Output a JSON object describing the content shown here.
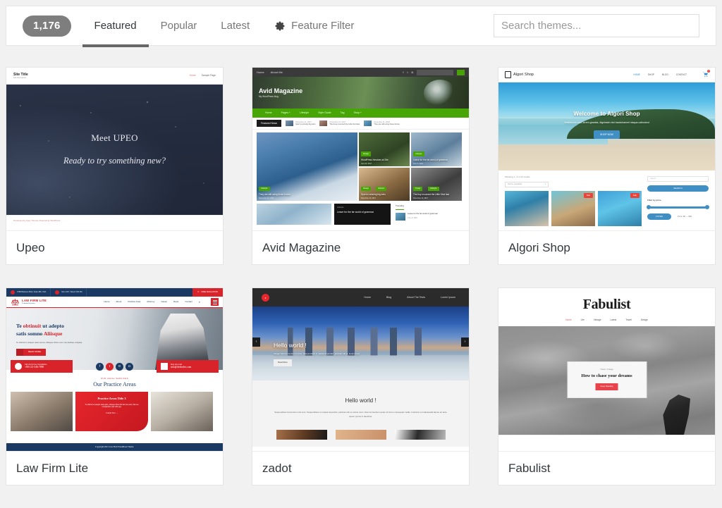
{
  "header": {
    "theme_count": "1,176",
    "tabs": [
      {
        "label": "Featured",
        "active": true
      },
      {
        "label": "Popular",
        "active": false
      },
      {
        "label": "Latest",
        "active": false
      }
    ],
    "feature_filter_label": "Feature Filter",
    "search_placeholder": "Search themes...",
    "search_value": ""
  },
  "themes": [
    {
      "name": "Upeo",
      "site_title": "Site Title",
      "site_tagline": "Site Description",
      "nav": [
        "Home",
        "Sample Page"
      ],
      "hero_line1": "Meet UPEO",
      "hero_line2": "Ready to try something new?",
      "footer": "Developed by Upeo Themes. Powered by WordPress."
    },
    {
      "name": "Avid Magazine",
      "topnav": [
        "Home",
        "About Me"
      ],
      "logo_title": "Avid Magazine",
      "logo_sub": "My WordPress blog",
      "nav": [
        "Home",
        "Pages +",
        "Lifestyle",
        "Style Guide",
        "Tag",
        "Shop +"
      ],
      "featured_tag": "Featured News",
      "featured_items": [
        {
          "date": "November 21, 2017",
          "title": "Sport is winning big wins"
        },
        {
          "date": "November 14, 2017",
          "title": "The boys mourned the Little Kind last"
        },
        {
          "date": "November 11, 2018",
          "title": "They are still using those forces"
        }
      ],
      "posts": [
        {
          "cat": "Lifestyle",
          "title": "They are still using those forces",
          "date": "November 21, 2018"
        },
        {
          "cat": "Design",
          "title": "WordPress Newbies at Site",
          "date": "June 24, 2017"
        },
        {
          "cat": "Lifestyle",
          "title": "Leave for the far world of grammar",
          "date": "June 6, 2018"
        },
        {
          "cat": "Design",
          "cat2": "Fashion",
          "title": "Sport is winning big wins",
          "date": "November 11, 2017"
        },
        {
          "cat": "Travel",
          "cat2": "Lifestyle",
          "title": "The boy mourned the Little Kind last",
          "date": "November 11, 2017"
        }
      ],
      "bottom_dark": {
        "cat": "Lifestyle",
        "title": "Leave for the far world of grammar"
      },
      "trending_label": "Trending",
      "trending_item": {
        "title": "Leave for the far world of grammar",
        "date": "June 6, 2018"
      }
    },
    {
      "name": "Algori Shop",
      "logo": "Algori Shop",
      "nav": [
        "HOME",
        "SHOP",
        "BLOG",
        "CONTACT"
      ],
      "cart_count": "0",
      "hero_title": "Welcome to Algori Shop",
      "hero_sub": "Vestibulum sed, lorem gravida, dignissim nisl backchannel nisqua callooked",
      "hero_button": "SHOP NOW",
      "results_text": "Showing 1 - 9 of 12 results",
      "sort_label": "Sort by popularity",
      "product_badge": "Sale",
      "search_placeholder": "Search...",
      "search_button": "SEARCH",
      "filter_title": "Filter by price",
      "filter_button": "FILTER",
      "price_range": "Price: $0 — $90"
    },
    {
      "name": "Law Firm Lite",
      "topbar": [
        "4789 Bellevue Blvd, Suite 380, USA",
        "Mon 24/7, Week 9:30 AM"
      ],
      "topbar_cta": "FREE EVALUATION",
      "logo_title": "LAW FIRM LITE",
      "logo_sub": "To defend of justice",
      "nav": [
        "Home",
        "About",
        "Practice Area",
        "Attorney",
        "Cases",
        "News",
        "Contact"
      ],
      "hero_title_1": "Te ",
      "hero_title_em": "obtinuit",
      "hero_title_2": " ut adepto",
      "hero_title_3": "satis somno ",
      "hero_title_em2": "Aliisque",
      "hero_sub": "Te obtinuit ut adepto satis somno. Aliisque tribus nunc mei deliciae voluptas.",
      "hero_button": "READ MORE",
      "call_label": "Call Us For Free Consultation",
      "call_number": "+88-123-546-7890",
      "email_label": "Drop Us a mail",
      "email_value": "info@defendex.com",
      "section_sub": "OUR LEGAL SERVICES",
      "section_title": "Our Practice Areas",
      "card_title": "Practice Areas Title 3",
      "card_text": "Te obtinuit ut adepto satis optio, aliisque tribus illa fac luar erant, illa mei complectitur pari mihi ego.",
      "card_link": "Consult Now →",
      "footer": "Copyright 2021 Law Firm WordPress Theme."
    },
    {
      "name": "zadot",
      "nav": [
        "Home",
        "Blog",
        "About The Tests",
        "Lorem Ipsum"
      ],
      "hero_title": "Hello world !",
      "hero_sub": "Integer felis fermentum in duis. Suspendisse in massa imperdiet, pulvinar elit ut, luctus nunc.",
      "hero_button": "Read More",
      "main_title": "Hello world !",
      "main_text": "Suspendisse fermentum nisl eros. Suspendisse in massa imperdiet, pulvinar elit ut, luctus nunc. Nam fermentum quam id lorem consequat mollis. Interdum et malesuada fames ac ante ipsum primis in faucibus."
    },
    {
      "name": "Fabulist",
      "logo": "Fabulist",
      "nav": [
        "Home",
        "Life",
        "Vintage",
        "Latest",
        "Travel",
        "Design"
      ],
      "card_cat": "Travel, Vintage",
      "card_title": "How to chase your dreams",
      "card_button": "Keep Reading"
    }
  ]
}
